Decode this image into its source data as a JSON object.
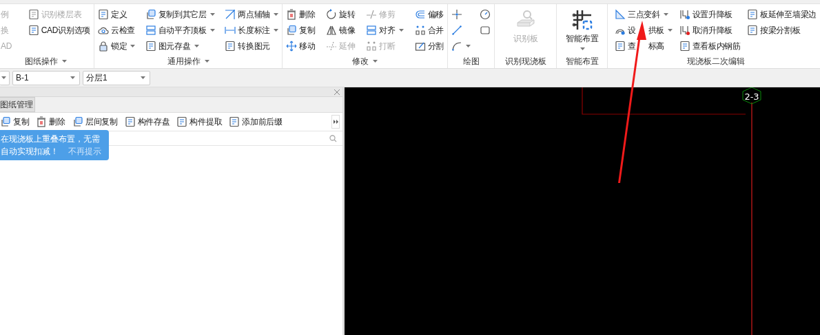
{
  "ribbon": {
    "groups": [
      {
        "label": "图纸操作",
        "menu": true,
        "columns": [
          [
            {
              "label": "例",
              "disabled": true,
              "dropdown": false
            },
            {
              "label": "换",
              "disabled": true,
              "dropdown": false
            },
            {
              "label": "AD",
              "disabled": true,
              "dropdown": false
            }
          ],
          [
            {
              "label": "识别楼层表",
              "disabled": true,
              "dropdown": false
            },
            {
              "label": "CAD识别选项",
              "disabled": false,
              "dropdown": false
            }
          ]
        ]
      },
      {
        "label": "通用操作",
        "menu": true,
        "columns": [
          [
            {
              "label": "定义",
              "disabled": false,
              "dropdown": false
            },
            {
              "label": "云检查",
              "disabled": false,
              "dropdown": false
            },
            {
              "label": "锁定",
              "disabled": false,
              "dropdown": true
            }
          ],
          [
            {
              "label": "复制到其它层",
              "disabled": false,
              "dropdown": true
            },
            {
              "label": "自动平齐顶板",
              "disabled": false,
              "dropdown": true
            },
            {
              "label": "图元存盘",
              "disabled": false,
              "dropdown": true
            }
          ],
          [
            {
              "label": "两点辅轴",
              "disabled": false,
              "dropdown": true
            },
            {
              "label": "长度标注",
              "disabled": false,
              "dropdown": true
            },
            {
              "label": "转换图元",
              "disabled": false,
              "dropdown": false
            }
          ]
        ]
      },
      {
        "label": "修改",
        "menu": true,
        "columns": [
          [
            {
              "label": "删除",
              "disabled": false,
              "dropdown": false
            },
            {
              "label": "复制",
              "disabled": false,
              "dropdown": false
            },
            {
              "label": "移动",
              "disabled": false,
              "dropdown": false
            }
          ],
          [
            {
              "label": "旋转",
              "disabled": false,
              "dropdown": false
            },
            {
              "label": "镜像",
              "disabled": false,
              "dropdown": false
            },
            {
              "label": "延伸",
              "disabled": true,
              "dropdown": false
            }
          ],
          [
            {
              "label": "修剪",
              "disabled": true,
              "dropdown": false
            },
            {
              "label": "对齐",
              "disabled": false,
              "dropdown": true
            },
            {
              "label": "打断",
              "disabled": true,
              "dropdown": false
            }
          ],
          [
            {
              "label": "偏移",
              "disabled": false,
              "dropdown": false
            },
            {
              "label": "合并",
              "disabled": false,
              "dropdown": false
            },
            {
              "label": "分割",
              "disabled": false,
              "dropdown": false
            }
          ]
        ]
      },
      {
        "label": "绘图",
        "menu": false,
        "columns": [
          [
            {
              "disabled": false,
              "dropdown": false
            },
            {
              "disabled": false,
              "dropdown": false
            },
            {
              "disabled": false,
              "dropdown": true
            }
          ],
          [
            {
              "disabled": false,
              "dropdown": false
            },
            {
              "disabled": false,
              "dropdown": false
            }
          ]
        ]
      },
      {
        "label": "识别现浇板",
        "menu": false,
        "big": {
          "label": "识别板",
          "disabled": true,
          "dropdown": false
        }
      },
      {
        "label": "智能布置",
        "menu": false,
        "big": {
          "label": "智能布置",
          "disabled": false,
          "dropdown": true
        }
      },
      {
        "label": "现浇板二次编辑",
        "menu": false,
        "columns": [
          [
            {
              "label": "三点变斜",
              "disabled": false,
              "dropdown": true
            },
            {
              "label": "设",
              "label_after": "拱板",
              "disabled": false,
              "dropdown": true
            },
            {
              "label": "查",
              "label_after": "标高",
              "disabled": false,
              "dropdown": false
            }
          ],
          [
            {
              "label": "设置升降板",
              "disabled": false,
              "dropdown": false
            },
            {
              "label": "取消升降板",
              "disabled": false,
              "dropdown": false
            },
            {
              "label": "查看板内钢筋",
              "disabled": false,
              "dropdown": false
            }
          ],
          [
            {
              "label": "板延伸至墙梁边",
              "disabled": false,
              "dropdown": false
            },
            {
              "label": "按梁分割板",
              "disabled": false,
              "dropdown": false
            }
          ]
        ]
      }
    ]
  },
  "selectors": [
    {
      "value": "B-1"
    },
    {
      "value": "分层1"
    }
  ],
  "panel": {
    "tabs": [
      {
        "label": "图纸管理",
        "selected": true
      }
    ],
    "toolbar": [
      "复制",
      "删除",
      "层间复制",
      "构件存盘",
      "构件提取",
      "添加前后缀"
    ],
    "tooltip": {
      "message": "在现浇板上重叠布置，无需自动实现扣减！",
      "link": "不再提示"
    }
  },
  "canvas": {
    "axis_label": "2-3"
  }
}
